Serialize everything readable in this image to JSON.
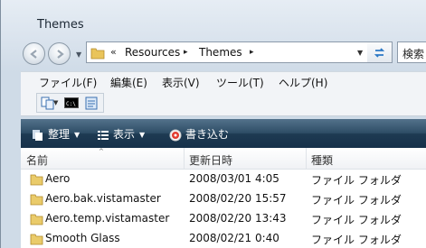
{
  "window": {
    "title": "Themes"
  },
  "address": {
    "root_marker": "«",
    "segments": [
      "Resources",
      "Themes"
    ],
    "separator": "▸",
    "search_placeholder": "検索"
  },
  "menu": [
    "ファイル(F)",
    "編集(E)",
    "表示(V)",
    "ツール(T)",
    "ヘルプ(H)"
  ],
  "toolbar_icons": [
    "copy-path-icon",
    "command-prompt-icon",
    "notepad-icon"
  ],
  "commands": {
    "organize": "整理",
    "view": "表示",
    "burn": "書き込む"
  },
  "columns": {
    "name": "名前",
    "modified": "更新日時",
    "type": "種類"
  },
  "sort_indicator": "^",
  "rows": [
    {
      "name": "Aero",
      "modified": "2008/03/01 4:05",
      "type": "ファイル フォルダ"
    },
    {
      "name": "Aero.bak.vistamaster",
      "modified": "2008/02/20 15:57",
      "type": "ファイル フォルダ"
    },
    {
      "name": "Aero.temp.vistamaster",
      "modified": "2008/02/20 13:43",
      "type": "ファイル フォルダ"
    },
    {
      "name": "Smooth Glass",
      "modified": "2008/02/21 0:40",
      "type": "ファイル フォルダ"
    }
  ]
}
